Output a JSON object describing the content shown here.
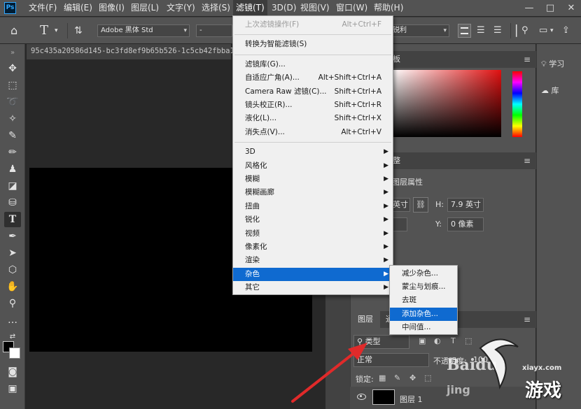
{
  "app": {
    "logo": "Ps",
    "menus": [
      "文件(F)",
      "编辑(E)",
      "图像(I)",
      "图层(L)",
      "文字(Y)",
      "选择(S)",
      "滤镜(T)",
      "3D(D)",
      "视图(V)",
      "窗口(W)",
      "帮助(H)"
    ],
    "window_controls": [
      "—",
      "□",
      "✕"
    ]
  },
  "options_bar": {
    "font_family": "Adobe 黑体 Std",
    "font_style": "-",
    "antialias": "锐利"
  },
  "document": {
    "tab_title": "95c435a20586d145-bc3fd8ef9b65b526-1c5cb42fbba16"
  },
  "filter_menu": {
    "groups": [
      [
        {
          "label": "上次滤镜操作(F)",
          "shortcut": "Alt+Ctrl+F",
          "disabled": true
        }
      ],
      [
        {
          "label": "转换为智能滤镜(S)",
          "shortcut": ""
        }
      ],
      [
        {
          "label": "滤镜库(G)...",
          "shortcut": ""
        },
        {
          "label": "自适应广角(A)...",
          "shortcut": "Alt+Shift+Ctrl+A"
        },
        {
          "label": "Camera Raw 滤镜(C)...",
          "shortcut": "Shift+Ctrl+A"
        },
        {
          "label": "镜头校正(R)...",
          "shortcut": "Shift+Ctrl+R"
        },
        {
          "label": "液化(L)...",
          "shortcut": "Shift+Ctrl+X"
        },
        {
          "label": "消失点(V)...",
          "shortcut": "Alt+Ctrl+V"
        }
      ],
      [
        {
          "label": "3D",
          "submenu": true
        },
        {
          "label": "风格化",
          "submenu": true
        },
        {
          "label": "模糊",
          "submenu": true
        },
        {
          "label": "模糊画廊",
          "submenu": true
        },
        {
          "label": "扭曲",
          "submenu": true
        },
        {
          "label": "锐化",
          "submenu": true
        },
        {
          "label": "视频",
          "submenu": true
        },
        {
          "label": "像素化",
          "submenu": true
        },
        {
          "label": "渲染",
          "submenu": true
        },
        {
          "label": "杂色",
          "submenu": true,
          "highlighted": true
        },
        {
          "label": "其它",
          "submenu": true
        }
      ]
    ]
  },
  "noise_submenu": {
    "items": [
      "减少杂色...",
      "蒙尘与划痕...",
      "去斑",
      "添加杂色...",
      "中间值..."
    ],
    "highlighted_index": 3
  },
  "panels": {
    "color_tab_partial": "板",
    "adjust_tab_partial": "整",
    "properties_title": "图层属性",
    "w_value_partial": "英寸",
    "h_label": "H:",
    "h_value": "7.9 英寸",
    "y_label": "Y:",
    "y_value": "0 像素",
    "layers_tab": "图层",
    "channels_tab_partial": "通",
    "filter_kind": "类型",
    "blend_mode": "正常",
    "opacity_label": "不透明度:",
    "opacity_value": "100",
    "lock_label": "锁定:",
    "layer_name": "图层 1"
  },
  "right_dock": {
    "items": [
      "学习",
      "库"
    ]
  },
  "watermarks": [
    "Baidu",
    "jing",
    "xiayx.com",
    "游戏"
  ],
  "colors": {
    "menu_highlight": "#0f6ad0",
    "arrow": "#e02a2a",
    "ui_dark": "#535353"
  }
}
